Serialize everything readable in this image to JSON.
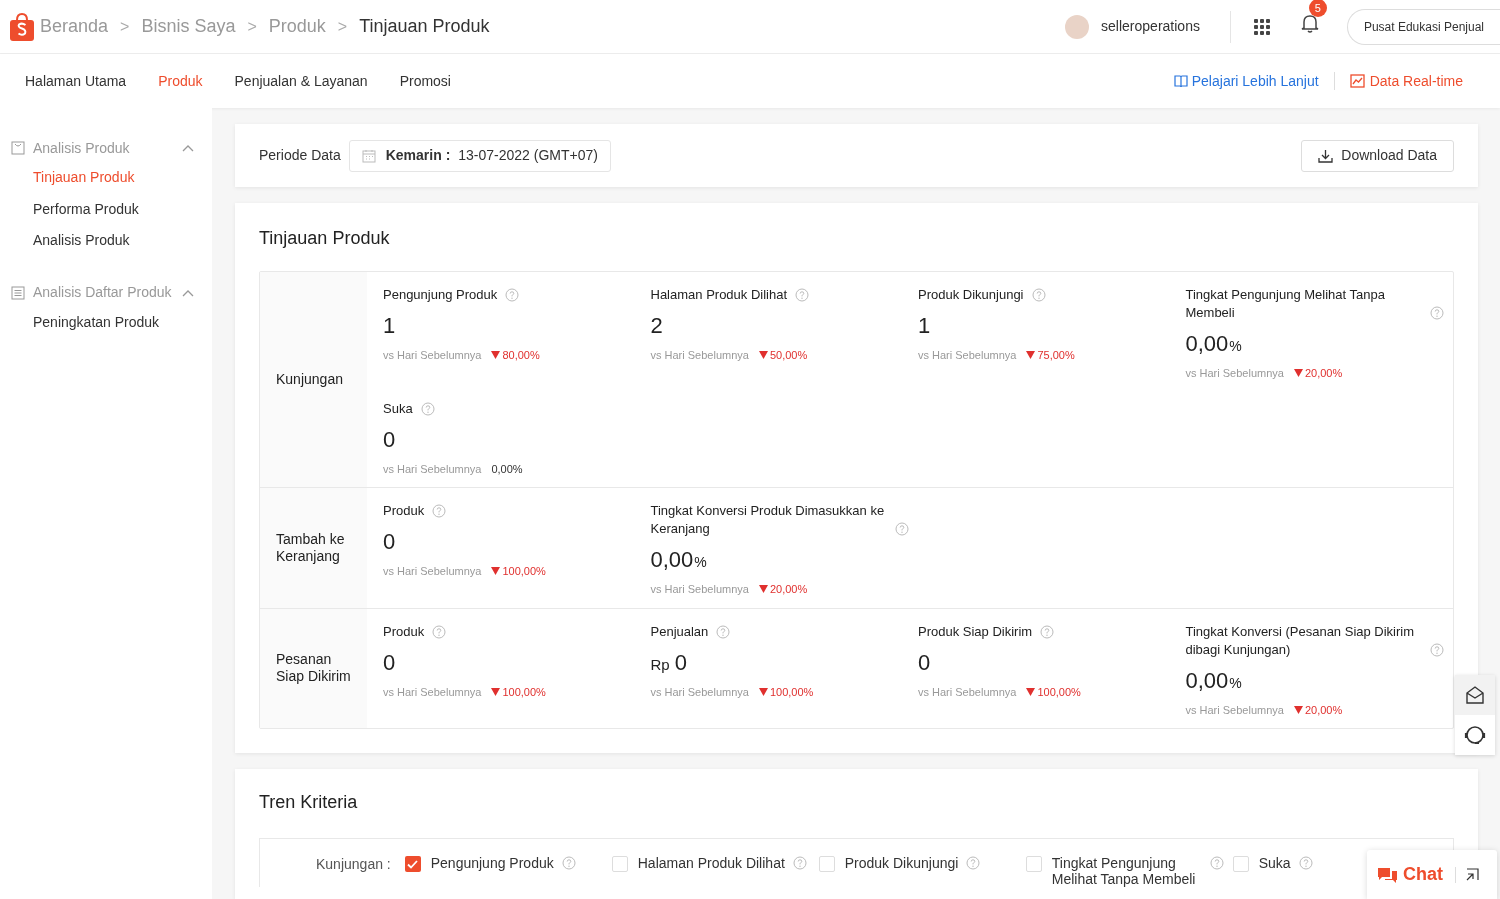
{
  "breadcrumb": [
    {
      "label": "Beranda",
      "current": false
    },
    {
      "label": "Bisnis Saya",
      "current": false
    },
    {
      "label": "Produk",
      "current": false
    },
    {
      "label": "Tinjauan Produk",
      "current": true
    }
  ],
  "breadcrumb_separator": ">",
  "user": {
    "name": "selleroperations",
    "notifications": "5",
    "edu_button": "Pusat Edukasi Penjual"
  },
  "tabs": [
    {
      "label": "Halaman Utama",
      "selected": false
    },
    {
      "label": "Produk",
      "selected": true
    },
    {
      "label": "Penjualan & Layanan",
      "selected": false
    },
    {
      "label": "Promosi",
      "selected": false
    }
  ],
  "header_links": {
    "learn_more": "Pelajari Lebih Lanjut",
    "realtime": "Data Real-time"
  },
  "sidebar": {
    "sections": [
      {
        "title": "Analisis Produk",
        "expanded": true,
        "items": [
          {
            "label": "Tinjauan Produk",
            "selected": true
          },
          {
            "label": "Performa Produk",
            "selected": false
          },
          {
            "label": "Analisis Produk",
            "selected": false
          }
        ]
      },
      {
        "title": "Analisis Daftar Produk",
        "expanded": true,
        "items": [
          {
            "label": "Peningkatan Produk",
            "selected": false
          }
        ]
      }
    ]
  },
  "period": {
    "label": "Periode Data",
    "range_label": "Kemarin :",
    "date": "13-07-2022 (GMT+07)",
    "download": "Download Data"
  },
  "overview": {
    "title": "Tinjauan Produk",
    "groups": [
      {
        "label": "Kunjungan",
        "metrics": [
          {
            "label": "Pengunjung Produk",
            "value": "1",
            "compare": "vs Hari Sebelumnya",
            "change": "80,00%",
            "kind": "decrease"
          },
          {
            "label": "Halaman Produk Dilihat",
            "value": "2",
            "compare": "vs Hari Sebelumnya",
            "change": "50,00%",
            "kind": "decrease"
          },
          {
            "label": "Produk Dikunjungi",
            "value": "1",
            "compare": "vs Hari Sebelumnya",
            "change": "75,00%",
            "kind": "decrease"
          },
          {
            "label": "Tingkat Pengunjung Melihat Tanpa Membeli",
            "value": "0,00",
            "suffix": "%",
            "compare": "vs Hari Sebelumnya",
            "change": "20,00%",
            "kind": "decrease"
          },
          {
            "label": "Suka",
            "value": "0",
            "compare": "vs Hari Sebelumnya",
            "change": "0,00%",
            "kind": "neutral"
          }
        ]
      },
      {
        "label": "Tambah ke Keranjang",
        "metrics": [
          {
            "label": "Produk",
            "value": "0",
            "compare": "vs Hari Sebelumnya",
            "change": "100,00%",
            "kind": "decrease"
          },
          {
            "label": "Tingkat Konversi Produk Dimasukkan ke Keranjang",
            "value": "0,00",
            "suffix": "%",
            "compare": "vs Hari Sebelumnya",
            "change": "20,00%",
            "kind": "decrease"
          }
        ]
      },
      {
        "label": "Pesanan Siap Dikirim",
        "metrics": [
          {
            "label": "Produk",
            "value": "0",
            "compare": "vs Hari Sebelumnya",
            "change": "100,00%",
            "kind": "decrease"
          },
          {
            "label": "Penjualan",
            "prefix": "Rp",
            "value": "0",
            "compare": "vs Hari Sebelumnya",
            "change": "100,00%",
            "kind": "decrease"
          },
          {
            "label": "Produk Siap Dikirim",
            "value": "0",
            "compare": "vs Hari Sebelumnya",
            "change": "100,00%",
            "kind": "decrease"
          },
          {
            "label": "Tingkat Konversi (Pesanan Siap Dikirim dibagi Kunjungan)",
            "value": "0,00",
            "suffix": "%",
            "compare": "vs Hari Sebelumnya",
            "change": "20,00%",
            "kind": "decrease"
          }
        ]
      }
    ]
  },
  "trend": {
    "title": "Tren Kriteria",
    "group_label": "Kunjungan :",
    "criteria": [
      {
        "label": "Pengunjung Produk",
        "checked": true
      },
      {
        "label": "Halaman Produk Dilihat",
        "checked": false
      },
      {
        "label": "Produk Dikunjungi",
        "checked": false
      },
      {
        "label": "Tingkat Pengunjung Melihat Tanpa Membeli",
        "checked": false
      },
      {
        "label": "Suka",
        "checked": false
      }
    ]
  },
  "chat": {
    "label": "Chat"
  }
}
